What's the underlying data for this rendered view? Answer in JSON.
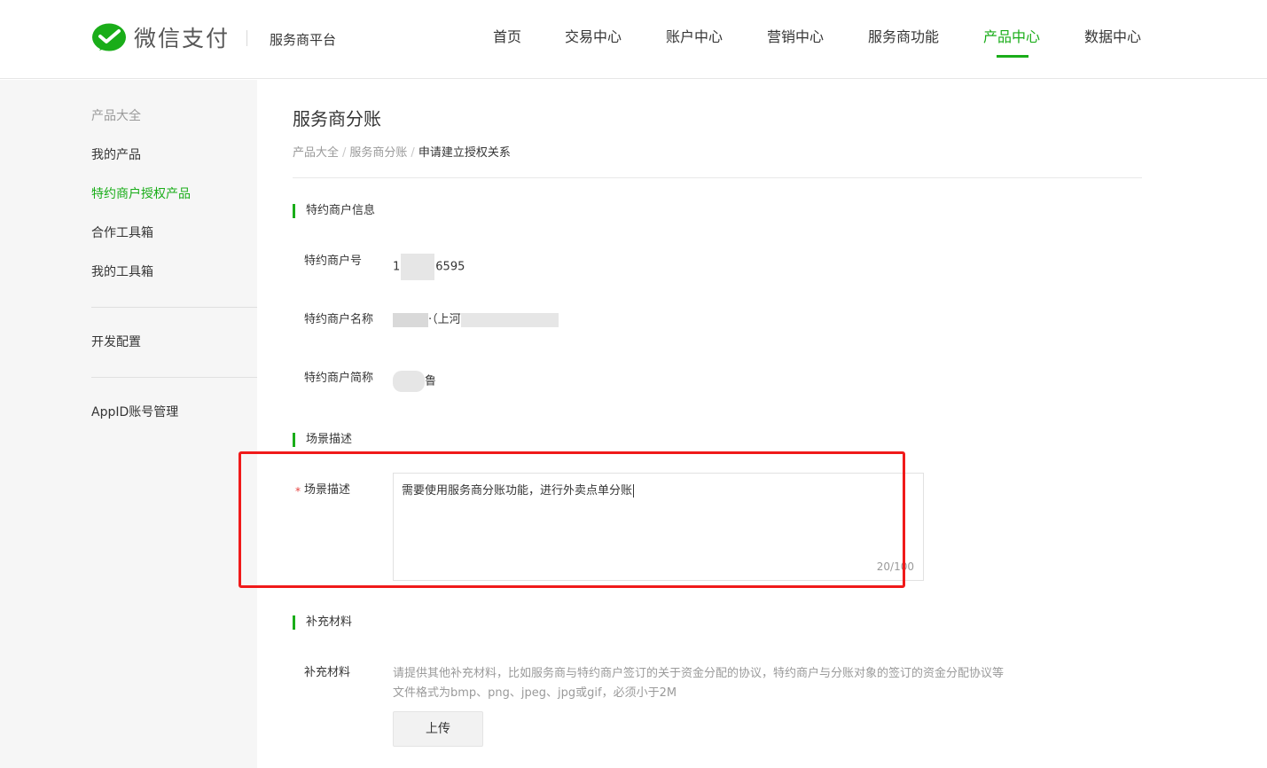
{
  "brand": {
    "logo_text": "微信支付",
    "platform_name": "服务商平台"
  },
  "nav": {
    "items": [
      {
        "label": "首页"
      },
      {
        "label": "交易中心"
      },
      {
        "label": "账户中心"
      },
      {
        "label": "营销中心"
      },
      {
        "label": "服务商功能"
      },
      {
        "label": "产品中心",
        "active": true
      },
      {
        "label": "数据中心"
      }
    ]
  },
  "sidebar": {
    "group_label": "产品大全",
    "items": [
      {
        "label": "我的产品"
      },
      {
        "label": "特约商户授权产品",
        "active": true
      },
      {
        "label": "合作工具箱"
      },
      {
        "label": "我的工具箱"
      },
      {
        "label": "开发配置"
      },
      {
        "label": "AppID账号管理"
      }
    ]
  },
  "page": {
    "title": "服务商分账",
    "breadcrumb": [
      "产品大全",
      "服务商分账",
      "申请建立授权关系"
    ]
  },
  "merchant_info": {
    "section_title": "特约商户信息",
    "id_label": "特约商户号",
    "id_prefix": "1",
    "id_suffix": "6595",
    "name_label": "特约商户名称",
    "name_partial": "·（上河",
    "short_label": "特约商户简称",
    "short_partial": "鲁"
  },
  "scene": {
    "section_title": "场景描述",
    "field_label": "场景描述",
    "required_mark": "*",
    "value": "需要使用服务商分账功能，进行外卖点单分账",
    "counter": "20/100"
  },
  "materials": {
    "section_title": "补充材料",
    "field_label": "补充材料",
    "hint_line1": "请提供其他补充材料，比如服务商与特约商户签订的关于资金分配的协议，特约商户与分账对象的签订的资金分配协议等",
    "hint_line2": "文件格式为bmp、png、jpeg、jpg或gif，必须小于2M",
    "upload_label": "上传"
  },
  "colors": {
    "accent": "#1aad19",
    "annotation": "#f01a1a",
    "required": "#e64340"
  }
}
